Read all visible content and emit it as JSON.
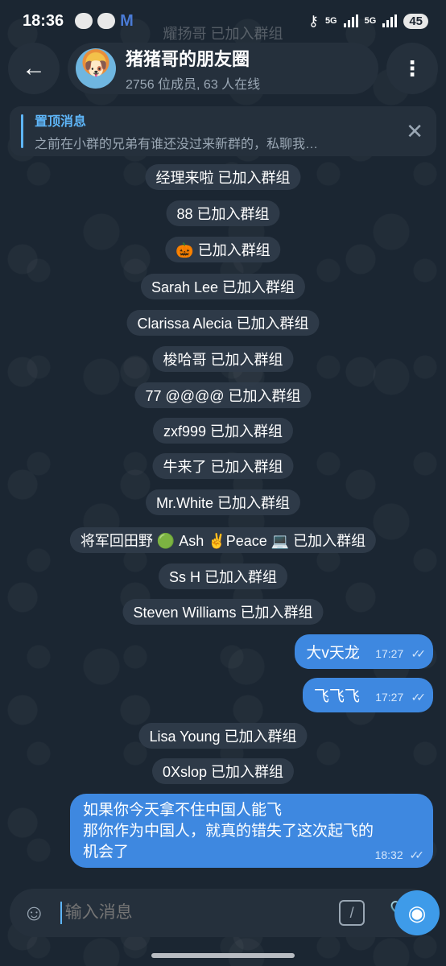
{
  "status": {
    "time": "18:36",
    "network1": "5G",
    "network2": "5G",
    "battery": "45"
  },
  "header": {
    "back_icon": "arrow-left-icon",
    "title": "猪猪哥的朋友圈",
    "subtitle": "2756 位成员, 63 人在线",
    "ghost": "耀扬哥 已加入群组",
    "more_icon": "more-vert-icon"
  },
  "pinned": {
    "label": "置顶消息",
    "text": "之前在小群的兄弟有谁还没过来新群的，私聊我…",
    "close_icon": "close-icon"
  },
  "service_messages": [
    "经理来啦 已加入群组",
    "88 已加入群组",
    "🎃 已加入群组",
    "Sarah Lee 已加入群组",
    "Clarissa Alecia 已加入群组",
    "梭哈哥 已加入群组",
    "77 @@@@ 已加入群组",
    "zxf999 已加入群组",
    "牛来了 已加入群组",
    "Mr.White 已加入群组",
    "将军回田野 🟢 Ash ✌️Peace 💻 已加入群组",
    "Ss H 已加入群组",
    "Steven Williams 已加入群组"
  ],
  "outgoing": [
    {
      "text": "大v天龙",
      "time": "17:27"
    },
    {
      "text": "飞飞飞",
      "time": "17:27"
    }
  ],
  "service_messages_2": [
    "Lisa Young 已加入群组",
    "0Xslop 已加入群组"
  ],
  "big_message": {
    "line1": "如果你今天拿不住中国人能飞",
    "line2": "那你作为中国人，就真的错失了这次起飞的",
    "line3": "机会了",
    "time": "18:32"
  },
  "input": {
    "placeholder": "输入消息",
    "emoji_icon": "emoji-icon",
    "command_icon": "command-slash-icon",
    "attach_icon": "paperclip-icon",
    "camera_icon": "camera-icon"
  }
}
